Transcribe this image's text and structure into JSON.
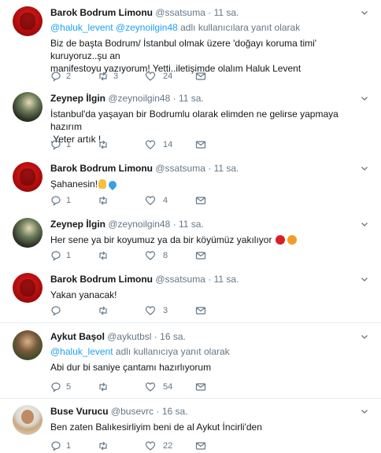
{
  "tweets": [
    {
      "name": "Barok Bodrum Limonu",
      "handle": "@ssatsuma",
      "time": "11 sa.",
      "reply_mentions": "@haluk_levent @zeynoilgin48",
      "reply_suffix": " adlı kullanıcılara yanıt olarak",
      "text_lines": [
        "Biz de başta Bodrum/ İstanbul olmak üzere 'doğayı koruma timi' kuruyoruz..şu an",
        "manifestoyu yazıyorum! Yetti..iletişimde olalım Haluk Levent"
      ],
      "replies": "2",
      "retweets": "3",
      "likes": "24",
      "avatar": "red"
    },
    {
      "name": "Zeynep İlgin",
      "handle": "@zeynoilgin48",
      "time": "11 sa.",
      "text_lines": [
        "İstanbul'da yaşayan bir Bodrumlu olarak elimden ne gelirse yapmaya hazırım",
        ".Yeter artık !"
      ],
      "replies": "1",
      "retweets": "",
      "likes": "14",
      "avatar": "dark"
    },
    {
      "name": "Barok Bodrum Limonu",
      "handle": "@ssatsuma",
      "time": "11 sa.",
      "text_lines": [
        "Şahanesin!"
      ],
      "emojis": [
        "praying-hands",
        "blue-heart"
      ],
      "replies": "1",
      "retweets": "",
      "likes": "4",
      "avatar": "red"
    },
    {
      "name": "Zeynep İlgin",
      "handle": "@zeynoilgin48",
      "time": "11 sa.",
      "text_lines": [
        "Her sene ya bir koyumuz ya da bir köyümüz yakılıyor"
      ],
      "emojis": [
        "pouting-face",
        "disappointed-face"
      ],
      "replies": "1",
      "retweets": "",
      "likes": "8",
      "avatar": "dark"
    },
    {
      "name": "Barok Bodrum Limonu",
      "handle": "@ssatsuma",
      "time": "11 sa.",
      "text_lines": [
        "Yakan yanacak!"
      ],
      "replies": "",
      "retweets": "",
      "likes": "3",
      "avatar": "red"
    },
    {
      "name": "Aykut Başol",
      "handle": "@aykutbsl",
      "time": "16 sa.",
      "reply_mentions": "@haluk_levent",
      "reply_suffix": " adlı kullanıcıya yanıt olarak",
      "text_lines": [
        "Abi dur bi saniye çantamı hazırlıyorum"
      ],
      "replies": "5",
      "retweets": "",
      "likes": "54",
      "avatar": "olive"
    },
    {
      "name": "Buse Vurucu",
      "handle": "@busevrc",
      "time": "16 sa.",
      "text_lines": [
        "Ben zaten Balıkesirliyim beni de al Aykut İncirli'den"
      ],
      "replies": "1",
      "retweets": "",
      "likes": "22",
      "avatar": "light"
    }
  ],
  "dot": "·",
  "colors": {
    "link": "#1da1f2",
    "meta": "#657786",
    "text": "#14171a",
    "separator": "#e6ecf0"
  }
}
